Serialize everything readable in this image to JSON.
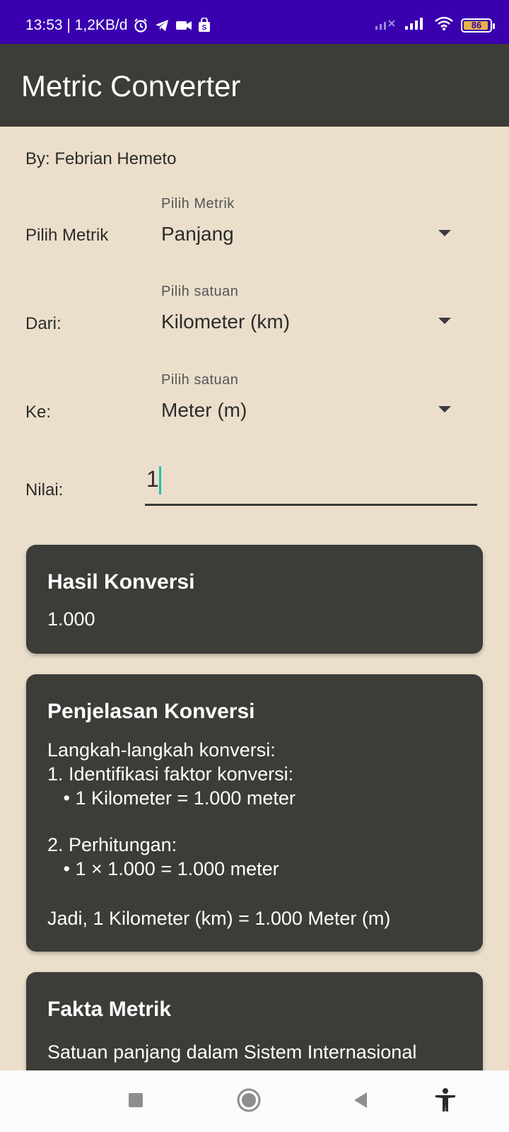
{
  "status_bar": {
    "time_text": "13:53 | 1,2KB/d",
    "battery": "86"
  },
  "app_bar": {
    "title": "Metric Converter"
  },
  "author": "By: Febrian Hemeto",
  "form": {
    "metric": {
      "label": "Pilih Metrik",
      "hint": "Pilih Metrik",
      "value": "Panjang"
    },
    "from": {
      "label": "Dari:",
      "hint": "Pilih satuan",
      "value": "Kilometer (km)"
    },
    "to": {
      "label": "Ke:",
      "hint": "Pilih satuan",
      "value": "Meter (m)"
    },
    "value": {
      "label": "Nilai:",
      "value": "1"
    }
  },
  "result_card": {
    "title": "Hasil Konversi",
    "value": "1.000"
  },
  "explain_card": {
    "title": "Penjelasan Konversi",
    "lines": [
      "Langkah-langkah konversi:",
      "1. Identifikasi faktor konversi:",
      "   • 1 Kilometer = 1.000 meter",
      "",
      "2. Perhitungan:",
      "   • 1 × 1.000 = 1.000 meter",
      "",
      "Jadi, 1 Kilometer (km) = 1.000 Meter (m)"
    ]
  },
  "fact_card": {
    "title": "Fakta Metrik",
    "body": "Satuan panjang dalam Sistem Internasional"
  },
  "colors": {
    "status_bar": "#3a00b0",
    "app_bar": "#3c3c38",
    "background": "#ebdfcb",
    "card": "#3c3c38",
    "cursor": "#1ec3b4"
  }
}
